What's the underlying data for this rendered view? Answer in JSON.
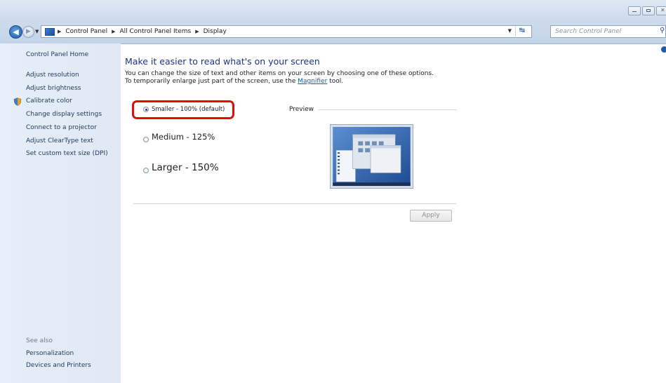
{
  "window": {
    "back_icon": "back-arrow-icon",
    "forward_icon": "forward-arrow-icon"
  },
  "address": {
    "crumbs": [
      "Control Panel",
      "All Control Panel Items",
      "Display"
    ],
    "search_placeholder": "Search Control Panel"
  },
  "sidebar": {
    "items": [
      "Control Panel Home",
      "Adjust resolution",
      "Adjust brightness",
      "Calibrate color",
      "Change display settings",
      "Connect to a projector",
      "Adjust ClearType text",
      "Set custom text size (DPI)"
    ],
    "see_also_label": "See also",
    "see_also": [
      "Personalization",
      "Devices and Printers"
    ]
  },
  "main": {
    "heading": "Make it easier to read what's on your screen",
    "desc_before": "You can change the size of text and other items on your screen by choosing one of these options. To temporarily enlarge just part of the screen, use the ",
    "desc_link": "Magnifier",
    "desc_after": " tool.",
    "options": [
      {
        "label": "Smaller - 100% (default)",
        "selected": true
      },
      {
        "label": "Medium - 125%",
        "selected": false
      },
      {
        "label": "Larger - 150%",
        "selected": false
      }
    ],
    "preview_label": "Preview",
    "apply_label": "Apply"
  },
  "colors": {
    "accent_highlight": "#e00d0d",
    "heading": "#1e3287",
    "sidebar_bg": "#e6eef8"
  }
}
